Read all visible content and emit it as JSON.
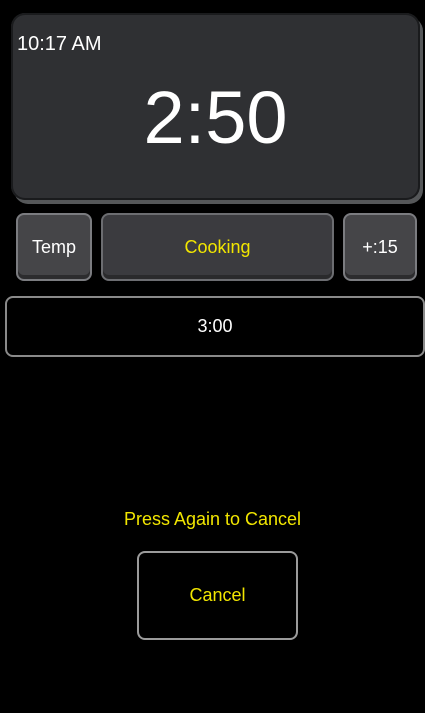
{
  "header": {
    "clock_time": "10:17 AM",
    "remaining_time": "2:50"
  },
  "controls": {
    "temp_label": "Temp",
    "status_label": "Cooking",
    "add_time_label": "+:15"
  },
  "set_time": {
    "value": "3:00"
  },
  "cancel_area": {
    "prompt": "Press Again to Cancel",
    "cancel_label": "Cancel"
  },
  "colors": {
    "accent_yellow": "#f2e600",
    "panel": "#2f3033",
    "button": "#454548",
    "background": "#000000"
  }
}
